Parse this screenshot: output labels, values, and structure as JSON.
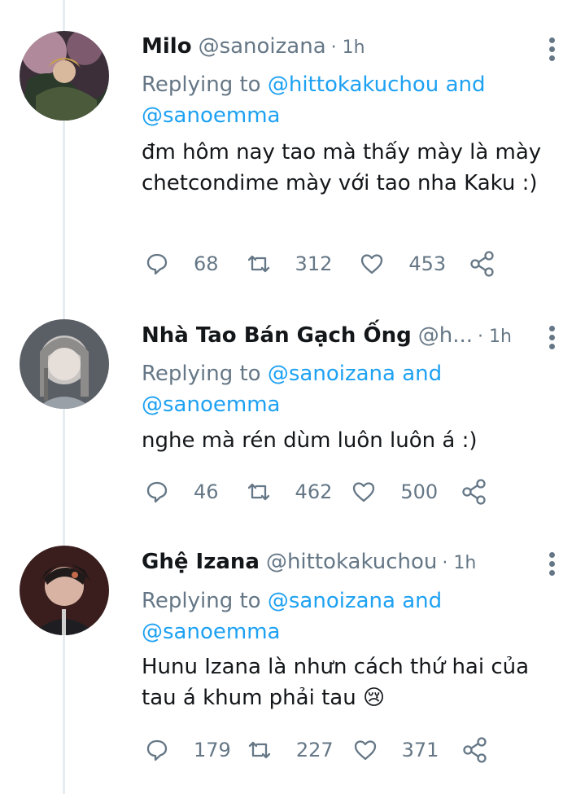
{
  "tweets": [
    {
      "name": "Milo",
      "handle": "@sanoizana",
      "time": "· 1h",
      "reply_prefix": "Replying to",
      "reply_mention_1": "@hittokakuchou",
      "reply_and": "and",
      "reply_mention_2": "@sanoemma",
      "text": "đm hôm nay tao mà thấy mày là mày chetcondime mày với tao nha Kaku :)",
      "replies": "68",
      "retweets": "312",
      "likes": "453"
    },
    {
      "name": "Nhà Tao Bán Gạch Ống",
      "handle": "@h...",
      "time": "· 1h",
      "reply_prefix": "Replying to",
      "reply_mention_1": "@sanoizana",
      "reply_and": "and",
      "reply_mention_2": "@sanoemma",
      "text": "nghe mà rén dùm luôn luôn á :)",
      "replies": "46",
      "retweets": "462",
      "likes": "500"
    },
    {
      "name": "Ghệ Izana",
      "handle": "@hittokakuchou",
      "time": "· 1h",
      "reply_prefix": "Replying to",
      "reply_mention_1": "@sanoizana",
      "reply_and": "and",
      "reply_mention_2": "@sanoemma",
      "text": "Hunu Izana là nhưn cách thứ hai của tau á khum phải tau 😢",
      "replies": "179",
      "retweets": "227",
      "likes": "371"
    }
  ],
  "colors": {
    "link": "#1da1f2",
    "muted": "#657786",
    "thread_line": "#e6ecf0"
  },
  "icons": [
    "comment-icon",
    "retweet-icon",
    "like-icon",
    "share-icon",
    "more-options-icon"
  ]
}
